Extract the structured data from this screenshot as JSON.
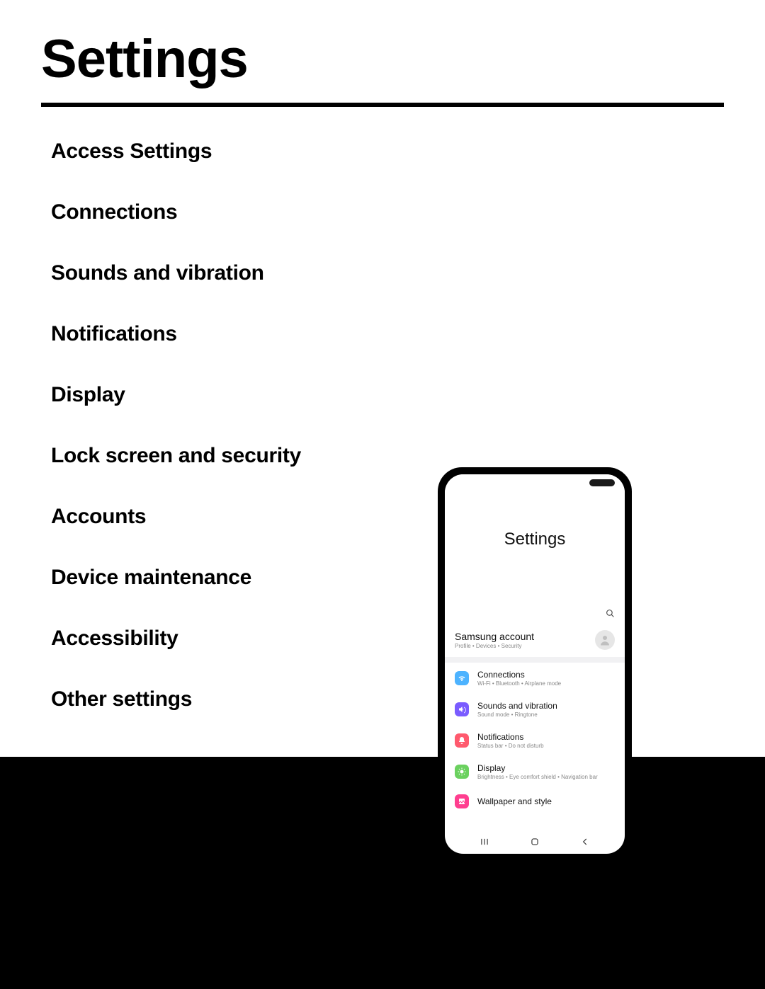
{
  "page": {
    "title": "Settings"
  },
  "toc": {
    "items": [
      {
        "label": "Access Settings"
      },
      {
        "label": "Connections"
      },
      {
        "label": "Sounds and vibration"
      },
      {
        "label": "Notifications"
      },
      {
        "label": "Display"
      },
      {
        "label": "Lock screen and security"
      },
      {
        "label": "Accounts"
      },
      {
        "label": "Device maintenance"
      },
      {
        "label": "Accessibility"
      },
      {
        "label": "Other settings"
      }
    ]
  },
  "phone": {
    "screen_title": "Settings",
    "account": {
      "title": "Samsung account",
      "subtitle": "Profile  •  Devices  •  Security"
    },
    "rows": [
      {
        "icon": "wifi-icon",
        "color": "#4db3ff",
        "title": "Connections",
        "subtitle": "Wi-Fi  •  Bluetooth  •  Airplane mode"
      },
      {
        "icon": "sound-icon",
        "color": "#7a5cff",
        "title": "Sounds and vibration",
        "subtitle": "Sound mode  •  Ringtone"
      },
      {
        "icon": "bell-icon",
        "color": "#ff5a6e",
        "title": "Notifications",
        "subtitle": "Status bar  •  Do not disturb"
      },
      {
        "icon": "display-icon",
        "color": "#6bd15f",
        "title": "Display",
        "subtitle": "Brightness  •  Eye comfort shield  •  Navigation bar"
      },
      {
        "icon": "wallpaper-icon",
        "color": "#ff3e8f",
        "title": "Wallpaper and style",
        "subtitle": ""
      }
    ],
    "nav": {
      "recents": "|||",
      "home": "◯",
      "back": "‹"
    }
  }
}
